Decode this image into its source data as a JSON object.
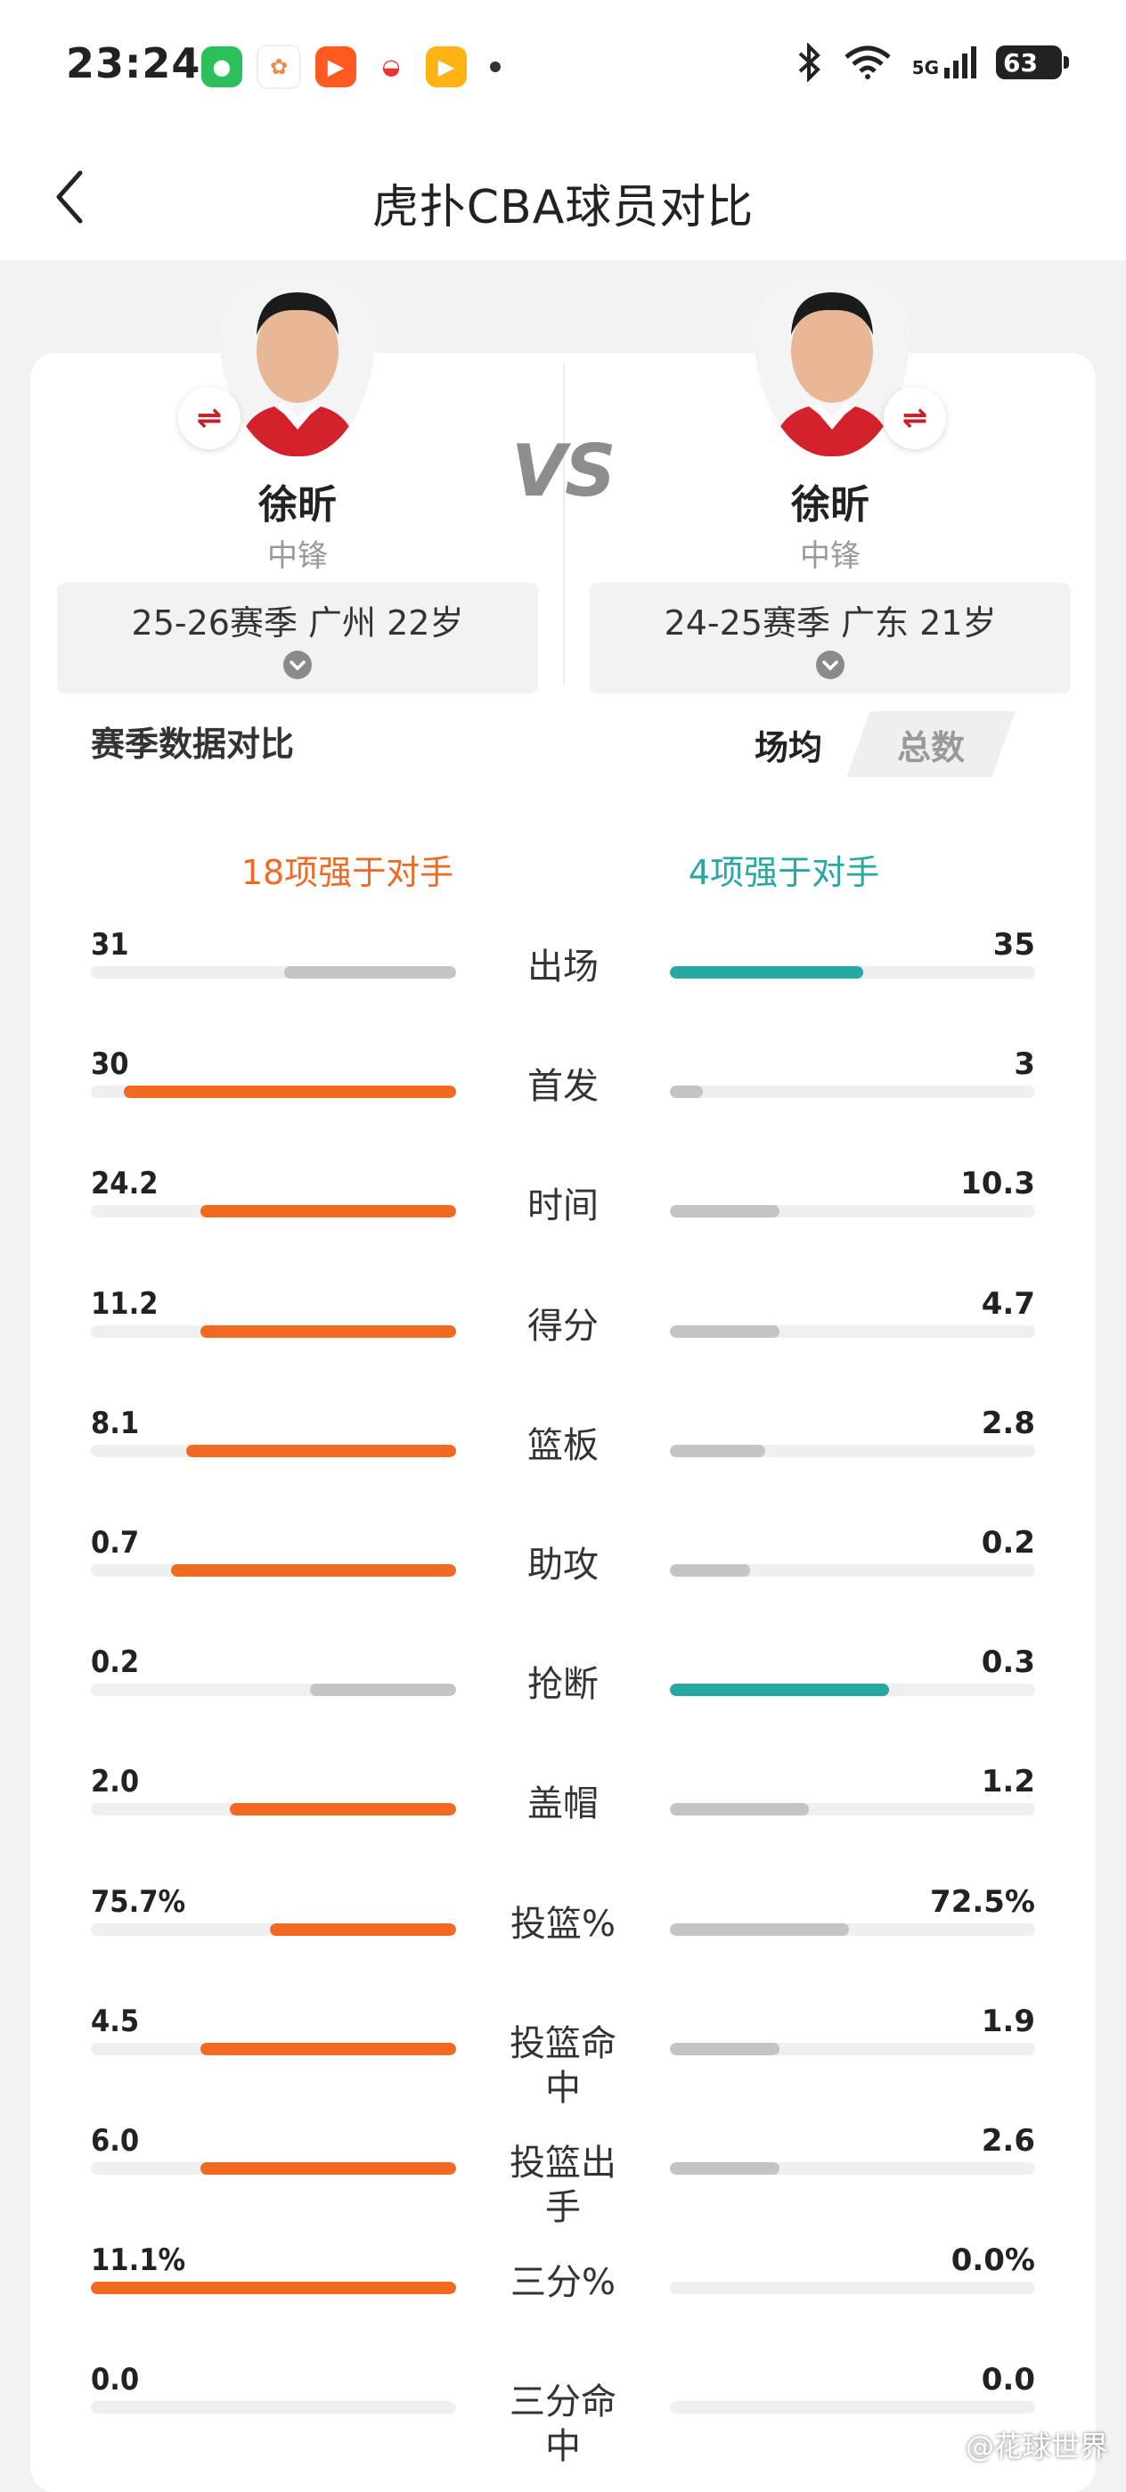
{
  "status_bar": {
    "time": "23:24",
    "network": "5G",
    "battery": "63"
  },
  "nav": {
    "title": "虎扑CBA球员对比"
  },
  "players": {
    "left": {
      "name": "徐昕",
      "position": "中锋",
      "season": "25-26赛季 广州 22岁"
    },
    "right": {
      "name": "徐昕",
      "position": "中锋",
      "season": "24-25赛季 广东 21岁"
    }
  },
  "vs_text": "VS",
  "section": {
    "title": "赛季数据对比",
    "tab_avg": "场均",
    "tab_total": "总数"
  },
  "summary": {
    "left": "18项强于对手",
    "right": "4项强于对手"
  },
  "colors": {
    "left_win": "#f26a21",
    "right_win": "#27a8a3",
    "lose": "#c4c4c4",
    "track": "#efefef"
  },
  "stats": [
    {
      "label": "出场",
      "left": "31",
      "right": "35",
      "left_share": 0.47,
      "right_share": 0.53,
      "winner": "right"
    },
    {
      "label": "首发",
      "left": "30",
      "right": "3",
      "left_share": 0.91,
      "right_share": 0.09,
      "winner": "left"
    },
    {
      "label": "时间",
      "left": "24.2",
      "right": "10.3",
      "left_share": 0.7,
      "right_share": 0.3,
      "winner": "left"
    },
    {
      "label": "得分",
      "left": "11.2",
      "right": "4.7",
      "left_share": 0.7,
      "right_share": 0.3,
      "winner": "left"
    },
    {
      "label": "篮板",
      "left": "8.1",
      "right": "2.8",
      "left_share": 0.74,
      "right_share": 0.26,
      "winner": "left"
    },
    {
      "label": "助攻",
      "left": "0.7",
      "right": "0.2",
      "left_share": 0.78,
      "right_share": 0.22,
      "winner": "left"
    },
    {
      "label": "抢断",
      "left": "0.2",
      "right": "0.3",
      "left_share": 0.4,
      "right_share": 0.6,
      "winner": "right"
    },
    {
      "label": "盖帽",
      "left": "2.0",
      "right": "1.2",
      "left_share": 0.62,
      "right_share": 0.38,
      "winner": "left"
    },
    {
      "label": "投篮%",
      "left": "75.7%",
      "right": "72.5%",
      "left_share": 0.51,
      "right_share": 0.49,
      "winner": "left"
    },
    {
      "label": "投篮命中",
      "left": "4.5",
      "right": "1.9",
      "left_share": 0.7,
      "right_share": 0.3,
      "winner": "left"
    },
    {
      "label": "投篮出手",
      "left": "6.0",
      "right": "2.6",
      "left_share": 0.7,
      "right_share": 0.3,
      "winner": "left"
    },
    {
      "label": "三分%",
      "left": "11.1%",
      "right": "0.0%",
      "left_share": 1.0,
      "right_share": 0.0,
      "winner": "left"
    },
    {
      "label": "三分命中",
      "left": "0.0",
      "right": "0.0",
      "left_share": 0.0,
      "right_share": 0.0,
      "winner": "none"
    }
  ],
  "watermark": "@花球世界"
}
